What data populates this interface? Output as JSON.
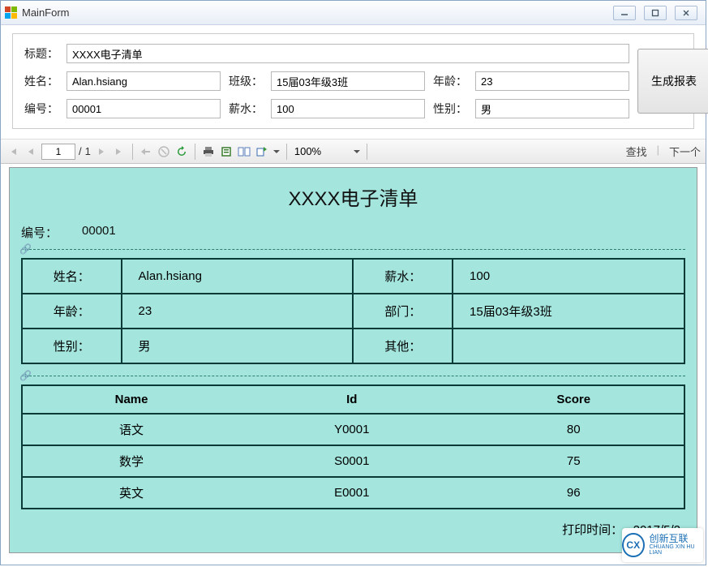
{
  "window": {
    "title": "MainForm"
  },
  "form": {
    "labels": {
      "title": "标题：",
      "name": "姓名：",
      "class": "班级：",
      "age": "年龄：",
      "id": "编号：",
      "salary": "薪水：",
      "gender": "性别："
    },
    "values": {
      "title": "XXXX电子清单",
      "name": "Alan.hsiang",
      "class": "15届03年级3班",
      "age": "23",
      "id": "00001",
      "salary": "100",
      "gender": "男"
    },
    "generate_button": "生成报表"
  },
  "toolbar": {
    "page_current": "1",
    "page_separator": "/",
    "page_total": "1",
    "zoom": "100%",
    "find": "查找",
    "next": "下一个"
  },
  "report": {
    "title": "XXXX电子清单",
    "head_id_label": "编号：",
    "head_id_value": "00001",
    "info": {
      "name_label": "姓名：",
      "name_value": "Alan.hsiang",
      "salary_label": "薪水：",
      "salary_value": "100",
      "age_label": "年龄：",
      "age_value": "23",
      "dept_label": "部门：",
      "dept_value": "15届03年级3班",
      "gender_label": "性别：",
      "gender_value": "男",
      "other_label": "其他：",
      "other_value": ""
    },
    "scores": {
      "headers": {
        "name": "Name",
        "id": "Id",
        "score": "Score"
      },
      "rows": [
        {
          "name": "语文",
          "id": "Y0001",
          "score": "80"
        },
        {
          "name": "数学",
          "id": "S0001",
          "score": "75"
        },
        {
          "name": "英文",
          "id": "E0001",
          "score": "96"
        }
      ]
    },
    "print_time_label": "打印时间：",
    "print_time_value": "2017/5/2"
  },
  "watermark": {
    "brand_short": "CX",
    "brand_cn": "创新互联",
    "brand_py": "CHUANG XIN HU LIAN"
  }
}
